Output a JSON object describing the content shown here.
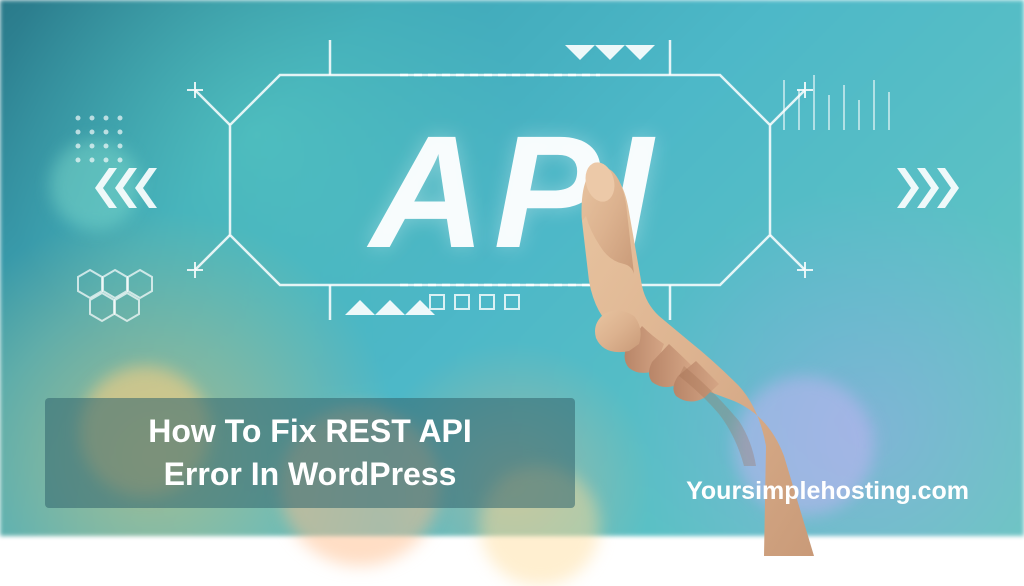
{
  "hero": {
    "api_label": "API",
    "title_line1": "How To Fix REST API",
    "title_line2": "Error In WordPress",
    "site_url": "Yoursimplehosting.com"
  },
  "colors": {
    "background_primary": "#3fa8b8",
    "text": "#ffffff",
    "title_bar_bg": "rgba(50,100,110,0.55)"
  }
}
